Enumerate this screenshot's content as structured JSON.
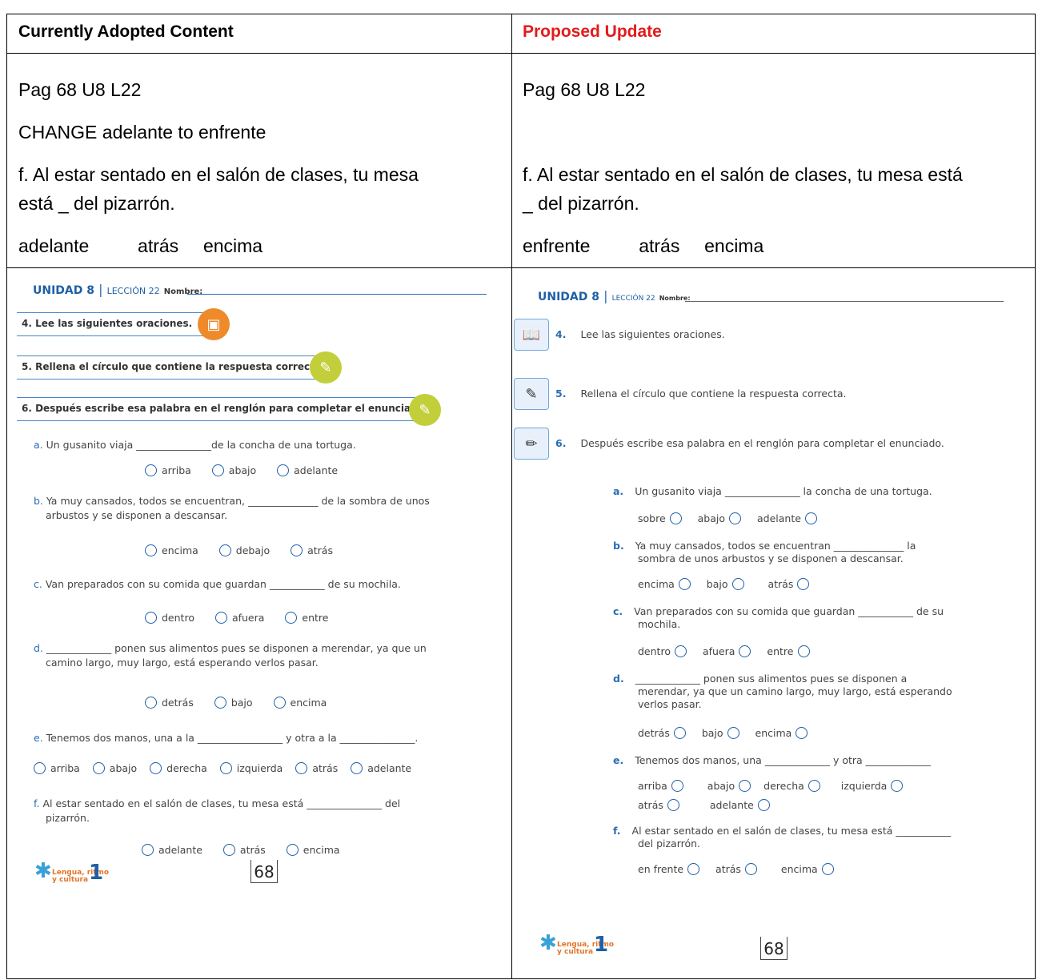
{
  "header": {
    "left": "Currently Adopted Content",
    "right": "Proposed Update",
    "right_color": "#e31b1b"
  },
  "current": {
    "page_ref": "Pag 68 U8 L22",
    "instruction": "CHANGE adelante to enfrente",
    "sentence_line1": "f. Al estar sentado en el salón de clases, tu mesa",
    "sentence_line2": "está _ del pizarrón.",
    "options": [
      "adelante",
      "atrás",
      "encima"
    ]
  },
  "proposed": {
    "page_ref": "Pag 68 U8 L22",
    "sentence_line1": "f. Al estar sentado en el salón de clases, tu mesa está",
    "sentence_line2": "_ del pizarrón.",
    "options": [
      "enfrente",
      "atrás",
      "encima"
    ]
  },
  "left_ws": {
    "unidad": "UNIDAD 8",
    "leccion": "LECCIÓN 22",
    "nombre": "Nombre:",
    "instr4": "4. Lee las siguientes oraciones.",
    "instr5": "5. Rellena el círculo que contiene la respuesta correcta.",
    "instr6": "6. Después escribe esa palabra en el renglón para completar el enunciado.",
    "qa": {
      "letter": "a.",
      "text": " Un gusanito viaja _______________de la concha de una tortuga.",
      "opts": [
        "arriba",
        "abajo",
        "adelante"
      ]
    },
    "qb": {
      "letter": "b.",
      "text1": " Ya muy cansados, todos se encuentran, ______________ de la sombra de unos",
      "text2": "arbustos y se disponen a descansar.",
      "opts": [
        "encima",
        "debajo",
        "atrás"
      ]
    },
    "qc": {
      "letter": "c.",
      "text": " Van preparados con su comida que guardan ___________ de su mochila.",
      "opts": [
        "dentro",
        "afuera",
        "entre"
      ]
    },
    "qd": {
      "letter": "d.",
      "text1": " _____________ ponen sus alimentos pues se disponen a merendar, ya que un",
      "text2": "camino largo, muy largo, está esperando verlos pasar.",
      "opts": [
        "detrás",
        "bajo",
        "encima"
      ]
    },
    "qe": {
      "letter": "e.",
      "text": " Tenemos dos manos, una a la _________________ y otra a la _______________.",
      "opts": [
        "arriba",
        "abajo",
        "derecha",
        "izquierda",
        "atrás",
        "adelante"
      ]
    },
    "qf": {
      "letter": "f.",
      "text1": " Al estar sentado en el salón de clases, tu mesa está _______________ del",
      "text2": "pizarrón.",
      "opts": [
        "adelante",
        "atrás",
        "encima"
      ]
    },
    "page_number": "68",
    "logo_text": "Lengua, ritmo y cultura",
    "logo_grade": "1"
  },
  "right_ws": {
    "unidad": "UNIDAD 8",
    "leccion": "LECCIÓN 22",
    "nombre": "Nombre:",
    "instr4_num": "4.",
    "instr4": "Lee las siguientes oraciones.",
    "instr5_num": "5.",
    "instr5": "Rellena el círculo que contiene la respuesta correcta.",
    "instr6_num": "6.",
    "instr6": "Después escribe esa palabra en el renglón para completar el enunciado.",
    "qa": {
      "letter": "a.",
      "text": "Un gusanito viaja _______________ la concha de una tortuga.",
      "opts": [
        "sobre",
        "abajo",
        "adelante"
      ]
    },
    "qb": {
      "letter": "b.",
      "text1": "Ya muy cansados, todos se encuentran ______________ la",
      "text2": "sombra de unos arbustos y se disponen a descansar.",
      "opts": [
        "encima",
        "bajo",
        "atrás"
      ]
    },
    "qc": {
      "letter": "c.",
      "text1": "Van preparados con su comida que guardan ___________ de su",
      "text2": "mochila.",
      "opts": [
        "dentro",
        "afuera",
        "entre"
      ]
    },
    "qd": {
      "letter": "d.",
      "text1": "_____________ ponen sus alimentos pues se disponen a",
      "text2": "merendar, ya que un camino largo, muy largo, está esperando",
      "text3": "verlos pasar.",
      "opts": [
        "detrás",
        "bajo",
        "encima"
      ]
    },
    "qe": {
      "letter": "e.",
      "text": "Tenemos dos manos, una _____________ y otra _____________",
      "opts1": [
        "arriba",
        "abajo",
        "derecha",
        "izquierda"
      ],
      "opts2": [
        "atrás",
        "adelante"
      ]
    },
    "qf": {
      "letter": "f.",
      "text1": "Al estar sentado en el salón de clases, tu mesa está ___________",
      "text2": "del pizarrón.",
      "opts": [
        "en frente",
        "atrás",
        "encima"
      ]
    },
    "page_number": "68",
    "logo_text": "Lengua, ritmo y cultura",
    "logo_grade": "1"
  }
}
